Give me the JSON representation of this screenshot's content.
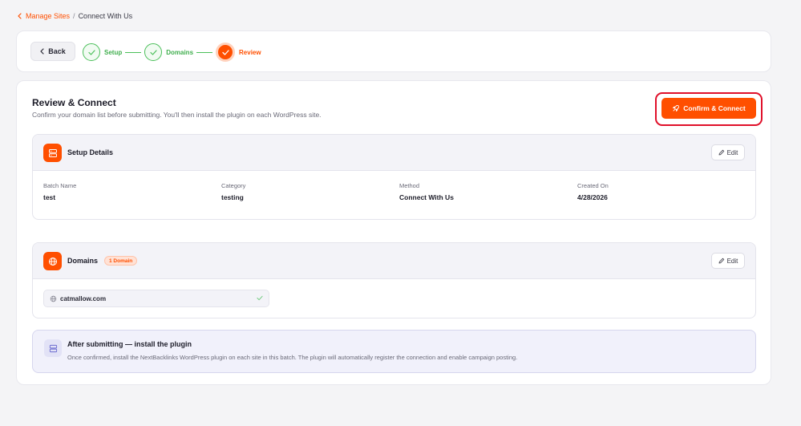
{
  "breadcrumb": {
    "parent": "Manage Sites",
    "separator": "/",
    "current": "Connect With Us"
  },
  "stepper": {
    "back_label": "Back",
    "steps": [
      {
        "label": "Setup",
        "state": "done"
      },
      {
        "label": "Domains",
        "state": "done"
      },
      {
        "label": "Review",
        "state": "active"
      }
    ]
  },
  "header": {
    "title": "Review & Connect",
    "subtitle": "Confirm your domain list before submitting. You'll then install the plugin on each WordPress site.",
    "confirm_label": "Confirm & Connect"
  },
  "setup_details": {
    "title": "Setup Details",
    "edit_label": "Edit",
    "fields": [
      {
        "label": "Batch Name",
        "value": "test"
      },
      {
        "label": "Category",
        "value": "testing"
      },
      {
        "label": "Method",
        "value": "Connect With Us"
      },
      {
        "label": "Created On",
        "value": "4/28/2026"
      }
    ]
  },
  "domains": {
    "title": "Domains",
    "badge": "1 Domain",
    "edit_label": "Edit",
    "items": [
      "catmallow.com"
    ]
  },
  "info": {
    "title": "After submitting — install the plugin",
    "text": "Once confirmed, install the NextBacklinks WordPress plugin on each site in this batch. The plugin will automatically register the connection and enable campaign posting."
  },
  "colors": {
    "accent": "#ff4f00",
    "success": "#4bbf5a",
    "highlight_border": "#e0102a"
  }
}
